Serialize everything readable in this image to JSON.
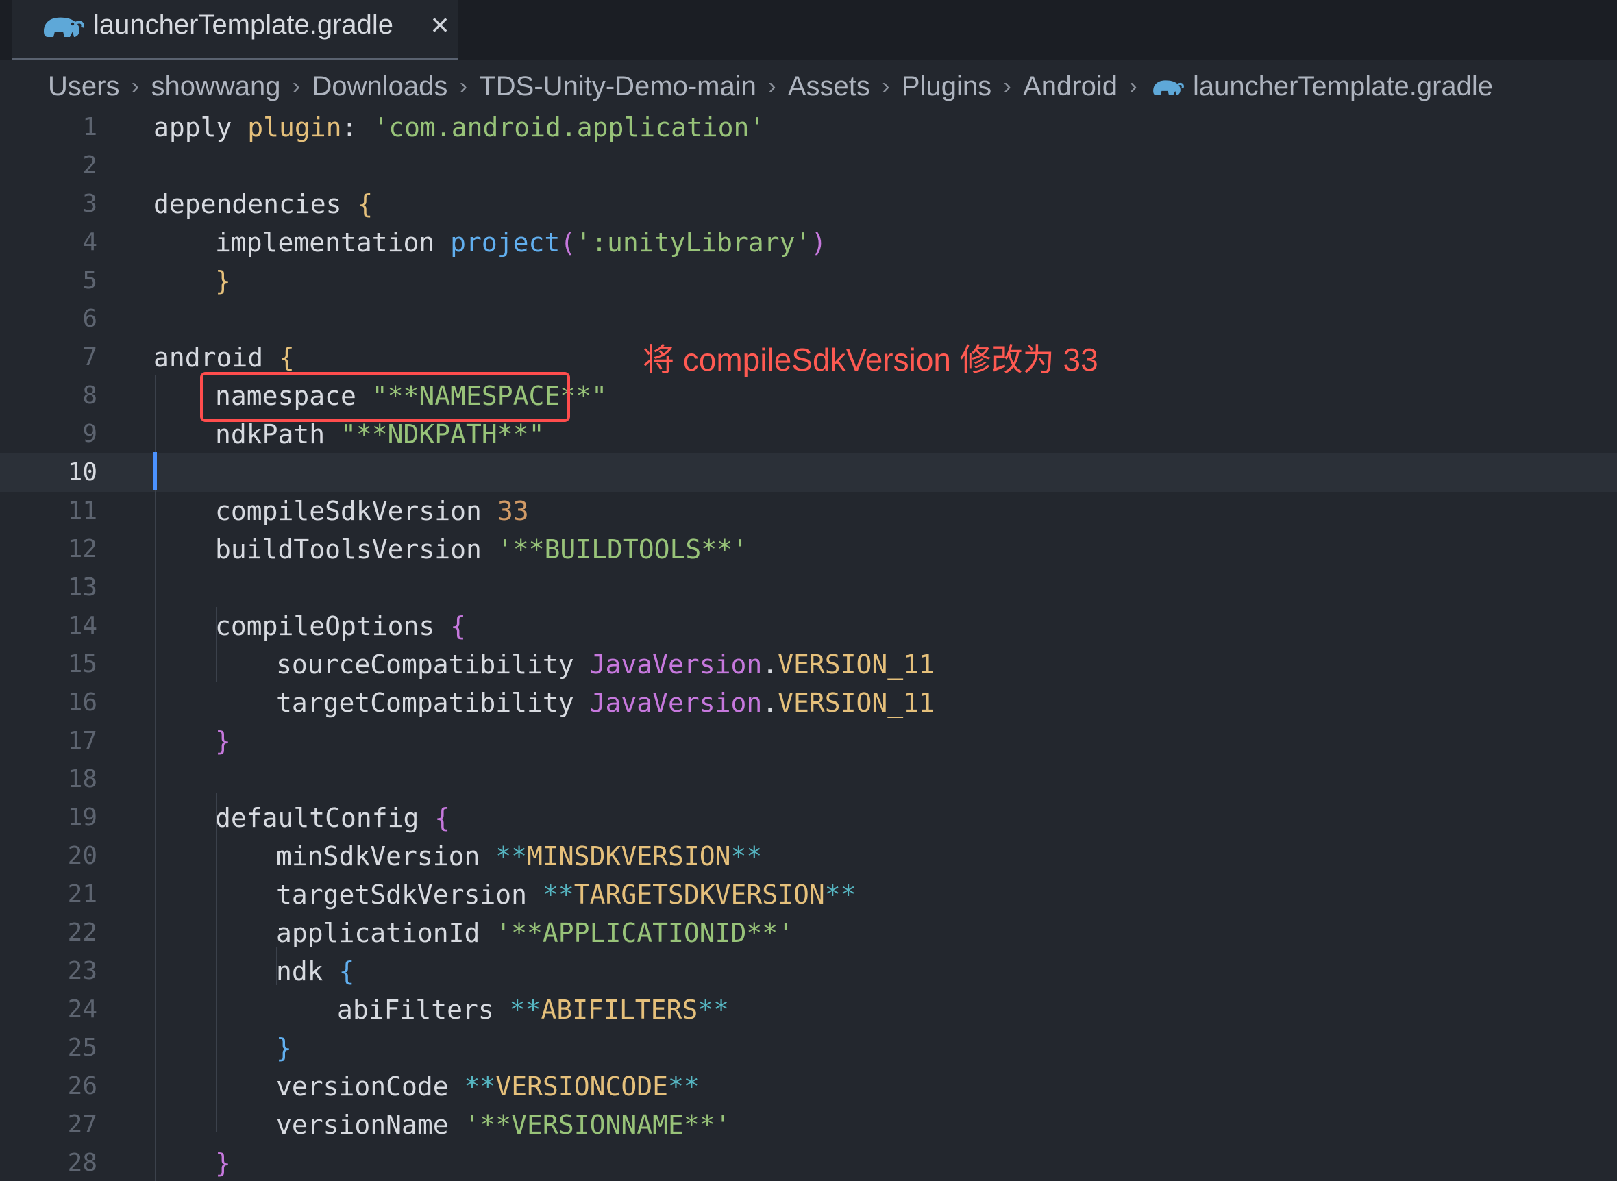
{
  "tab": {
    "file_name": "launcherTemplate.gradle",
    "close_glyph": "×",
    "icon": "gradle-elephant-icon"
  },
  "breadcrumb": {
    "items": [
      "Users",
      "showwang",
      "Downloads",
      "TDS-Unity-Demo-main",
      "Assets",
      "Plugins",
      "Android",
      "launcherTemplate.gradle"
    ],
    "separator": "›"
  },
  "annotation": {
    "text": "将 compileSdkVersion 修改为 33",
    "color": "#ff5a52"
  },
  "editor": {
    "active_line": 10,
    "lines": [
      {
        "n": "1",
        "indent": 0,
        "parts": [
          [
            "kw",
            "apply "
          ],
          [
            "plugin",
            "plugin"
          ],
          [
            "kw",
            ": "
          ],
          [
            "str",
            "'com.android.application'"
          ]
        ]
      },
      {
        "n": "2",
        "indent": 0,
        "parts": []
      },
      {
        "n": "3",
        "indent": 0,
        "parts": [
          [
            "kw",
            "dependencies "
          ],
          [
            "brace-y",
            "{"
          ]
        ]
      },
      {
        "n": "4",
        "indent": 1,
        "parts": [
          [
            "kw",
            "implementation "
          ],
          [
            "fn",
            "project"
          ],
          [
            "brace-p",
            "("
          ],
          [
            "str",
            "':unityLibrary'"
          ],
          [
            "brace-p",
            ")"
          ]
        ]
      },
      {
        "n": "5",
        "indent": 1,
        "parts": [
          [
            "brace-y",
            "}"
          ]
        ]
      },
      {
        "n": "6",
        "indent": 0,
        "parts": []
      },
      {
        "n": "7",
        "indent": 0,
        "parts": [
          [
            "kw",
            "android "
          ],
          [
            "brace-y",
            "{"
          ]
        ]
      },
      {
        "n": "8",
        "indent": 1,
        "parts": [
          [
            "kw",
            "namespace "
          ],
          [
            "str",
            "\"**NAMESPACE**\""
          ]
        ]
      },
      {
        "n": "9",
        "indent": 1,
        "parts": [
          [
            "kw",
            "ndkPath "
          ],
          [
            "str",
            "\"**NDKPATH**\""
          ]
        ]
      },
      {
        "n": "10",
        "indent": 1,
        "parts": []
      },
      {
        "n": "11",
        "indent": 1,
        "parts": [
          [
            "kw",
            "compileSdkVersion "
          ],
          [
            "num",
            "33"
          ]
        ]
      },
      {
        "n": "12",
        "indent": 1,
        "parts": [
          [
            "kw",
            "buildToolsVersion "
          ],
          [
            "str",
            "'**BUILDTOOLS**'"
          ]
        ]
      },
      {
        "n": "13",
        "indent": 1,
        "parts": []
      },
      {
        "n": "14",
        "indent": 1,
        "parts": [
          [
            "kw",
            "compileOptions "
          ],
          [
            "brace-p",
            "{"
          ]
        ]
      },
      {
        "n": "15",
        "indent": 2,
        "parts": [
          [
            "kw",
            "sourceCompatibility "
          ],
          [
            "cls",
            "JavaVersion"
          ],
          [
            "kw",
            "."
          ],
          [
            "enum",
            "VERSION_11"
          ]
        ]
      },
      {
        "n": "16",
        "indent": 2,
        "parts": [
          [
            "kw",
            "targetCompatibility "
          ],
          [
            "cls",
            "JavaVersion"
          ],
          [
            "kw",
            "."
          ],
          [
            "enum",
            "VERSION_11"
          ]
        ]
      },
      {
        "n": "17",
        "indent": 1,
        "parts": [
          [
            "brace-p",
            "}"
          ]
        ]
      },
      {
        "n": "18",
        "indent": 1,
        "parts": []
      },
      {
        "n": "19",
        "indent": 1,
        "parts": [
          [
            "kw",
            "defaultConfig "
          ],
          [
            "brace-p",
            "{"
          ]
        ]
      },
      {
        "n": "20",
        "indent": 2,
        "parts": [
          [
            "kw",
            "minSdkVersion "
          ],
          [
            "star",
            "**"
          ],
          [
            "placeholder",
            "MINSDKVERSION"
          ],
          [
            "star",
            "**"
          ]
        ]
      },
      {
        "n": "21",
        "indent": 2,
        "parts": [
          [
            "kw",
            "targetSdkVersion "
          ],
          [
            "star",
            "**"
          ],
          [
            "placeholder",
            "TARGETSDKVERSION"
          ],
          [
            "star",
            "**"
          ]
        ]
      },
      {
        "n": "22",
        "indent": 2,
        "parts": [
          [
            "kw",
            "applicationId "
          ],
          [
            "str",
            "'**APPLICATIONID**'"
          ]
        ]
      },
      {
        "n": "23",
        "indent": 2,
        "parts": [
          [
            "kw",
            "ndk "
          ],
          [
            "brace-b",
            "{"
          ]
        ]
      },
      {
        "n": "24",
        "indent": 3,
        "parts": [
          [
            "kw",
            "abiFilters "
          ],
          [
            "star",
            "**"
          ],
          [
            "placeholder",
            "ABIFILTERS"
          ],
          [
            "star",
            "**"
          ]
        ]
      },
      {
        "n": "25",
        "indent": 2,
        "parts": [
          [
            "brace-b",
            "}"
          ]
        ]
      },
      {
        "n": "26",
        "indent": 2,
        "parts": [
          [
            "kw",
            "versionCode "
          ],
          [
            "star",
            "**"
          ],
          [
            "placeholder",
            "VERSIONCODE"
          ],
          [
            "star",
            "**"
          ]
        ]
      },
      {
        "n": "27",
        "indent": 2,
        "parts": [
          [
            "kw",
            "versionName "
          ],
          [
            "str",
            "'**VERSIONNAME**'"
          ]
        ]
      },
      {
        "n": "28",
        "indent": 1,
        "parts": [
          [
            "brace-p",
            "}"
          ]
        ]
      }
    ]
  }
}
